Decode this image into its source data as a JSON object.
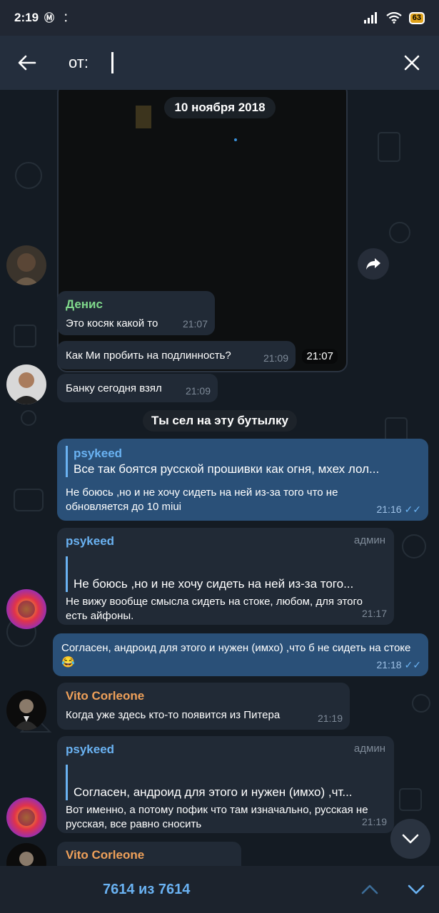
{
  "status_bar": {
    "time": "2:19",
    "battery": "63"
  },
  "search": {
    "label": "от:",
    "value": ""
  },
  "chat": {
    "media_time": "21:07",
    "date_pill": "10 ноября 2018",
    "service_pill": "Ты сел на эту бутылку",
    "messages": [
      {
        "sender": "Денис",
        "text": "Это косяк какой то",
        "time": "21:07"
      },
      {
        "text": "Как Ми пробить на подлинность?",
        "time": "21:09"
      },
      {
        "text": "Банку сегодня взял",
        "time": "21:09"
      },
      {
        "reply_to": "psykeed",
        "reply_text": "Все так боятся русской прошивки как огня, мхех лол...",
        "text": "Не боюсь ,но и не хочу сидеть на ней из-за того что не обновляется до 10 miui",
        "time": "21:16"
      },
      {
        "sender": "psykeed",
        "role": "админ",
        "reply_text": "Не боюсь ,но и не хочу сидеть на ней из-за того...",
        "text": "Не вижу вообще смысла сидеть на стоке, любом, для этого есть айфоны.",
        "time": "21:17"
      },
      {
        "text": "Согласен, андроид для этого и нужен (имхо) ,что б не сидеть на стоке😂",
        "time": "21:18"
      },
      {
        "sender": "Vito Corleone",
        "text": "Когда уже здесь кто-то появится из Питера",
        "time": "21:19"
      },
      {
        "sender": "psykeed",
        "role": "админ",
        "reply_text": "Согласен, андроид для этого и нужен (имхо) ,чт...",
        "text": "Вот именно, а потому пофик что там изначально, русская не русская, все равно сносить",
        "time": "21:19"
      },
      {
        "sender": "Vito Corleone"
      }
    ]
  },
  "bottom": {
    "counter": "7614 из 7614"
  },
  "colors": {
    "accent": "#6ab2f2",
    "bubble_in": "#212a36",
    "bubble_out": "#2a5078"
  }
}
